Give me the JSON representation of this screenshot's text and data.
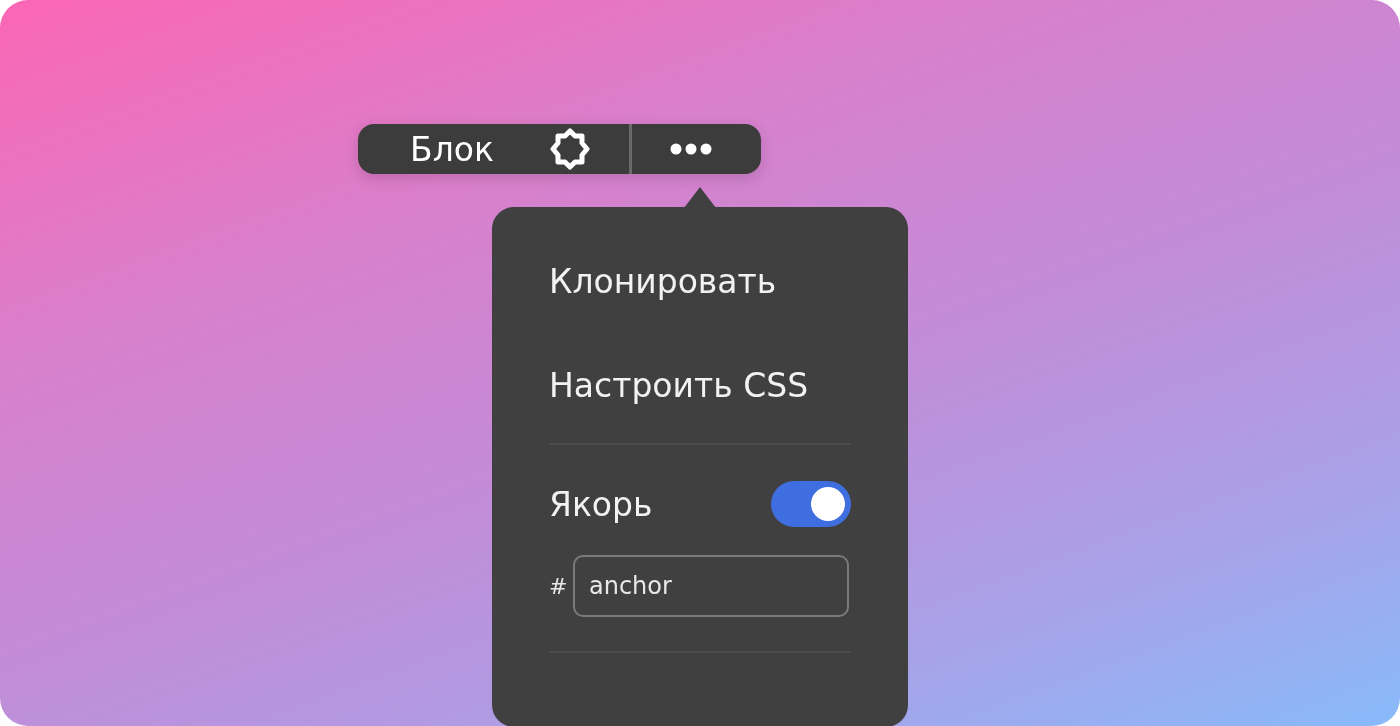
{
  "toolbar": {
    "title": "Блок"
  },
  "menu": {
    "actions": [
      {
        "label": "Клонировать"
      },
      {
        "label": "Настроить CSS"
      }
    ],
    "anchor": {
      "label": "Якорь",
      "on": true,
      "prefix": "#",
      "value": "anchor"
    }
  }
}
